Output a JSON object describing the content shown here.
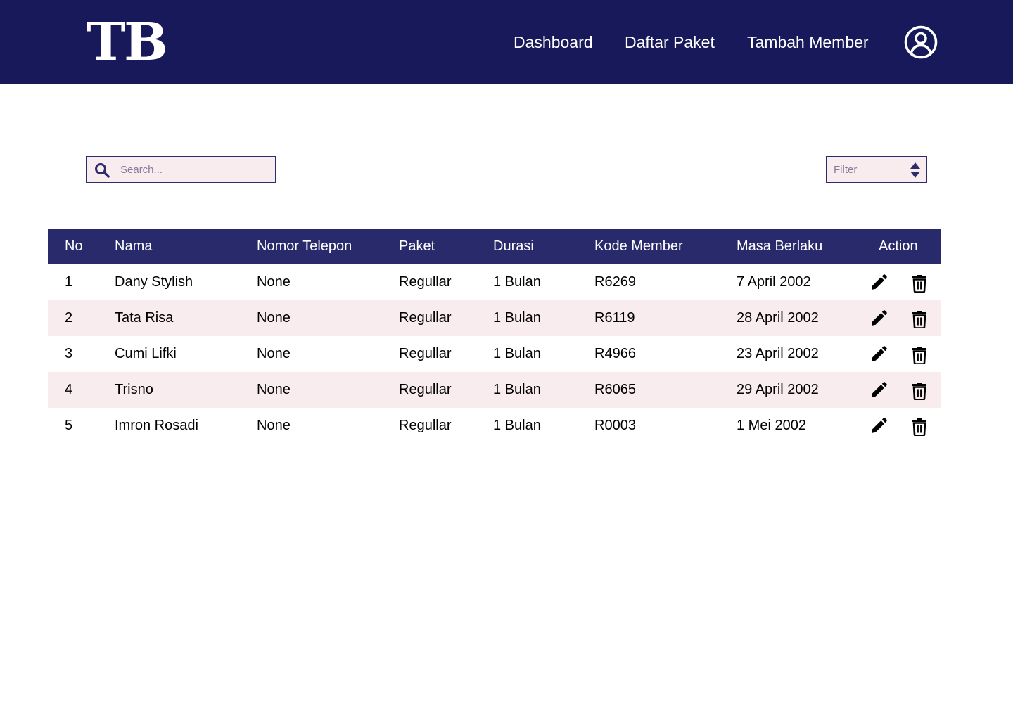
{
  "brand": {
    "logo_text": "TB"
  },
  "nav": {
    "links": [
      "Dashboard",
      "Daftar Paket",
      "Tambah Member"
    ]
  },
  "search": {
    "placeholder": "Search..."
  },
  "filter": {
    "label": "Filter"
  },
  "table": {
    "headers": [
      "No",
      "Nama",
      "Nomor Telepon",
      "Paket",
      "Durasi",
      "Kode Member",
      "Masa Berlaku",
      "Action"
    ],
    "rows": [
      {
        "no": "1",
        "nama": "Dany Stylish",
        "telepon": "None",
        "paket": "Regullar",
        "durasi": "1 Bulan",
        "kode": "R6269",
        "masa": "7 April 2002"
      },
      {
        "no": "2",
        "nama": "Tata Risa",
        "telepon": "None",
        "paket": "Regullar",
        "durasi": "1 Bulan",
        "kode": "R6119",
        "masa": "28 April 2002"
      },
      {
        "no": "3",
        "nama": "Cumi Lifki",
        "telepon": "None",
        "paket": "Regullar",
        "durasi": "1 Bulan",
        "kode": "R4966",
        "masa": "23 April 2002"
      },
      {
        "no": "4",
        "nama": "Trisno",
        "telepon": "None",
        "paket": "Regullar",
        "durasi": "1 Bulan",
        "kode": "R6065",
        "masa": "29 April 2002"
      },
      {
        "no": "5",
        "nama": "Imron Rosadi",
        "telepon": "None",
        "paket": "Regullar",
        "durasi": "1 Bulan",
        "kode": "R0003",
        "masa": "1 Mei 2002"
      }
    ]
  },
  "icons": {
    "user": "user-circle-icon",
    "search": "search-icon",
    "sort": "sort-icon",
    "edit": "pencil-icon",
    "delete": "trash-icon"
  },
  "colors": {
    "navbar": "#18195a",
    "table_header": "#292a6b",
    "row_alt": "#f9ecee",
    "input_bg": "#f9ecef"
  }
}
